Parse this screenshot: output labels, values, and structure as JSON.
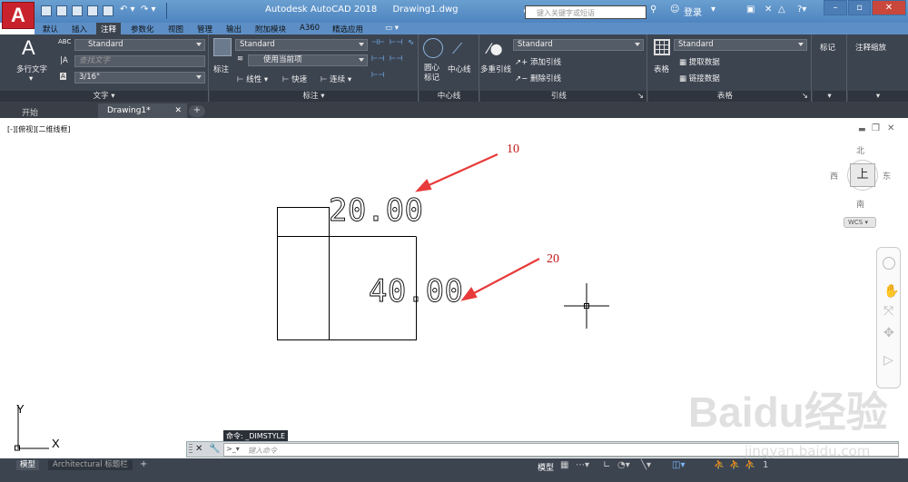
{
  "titlebar": {
    "app_title": "Autodesk AutoCAD 2018",
    "file": "Drawing1.dwg",
    "search_placeholder": "键入关键字或短语",
    "login": "登录"
  },
  "tabs": [
    "默认",
    "插入",
    "注释",
    "参数化",
    "视图",
    "管理",
    "输出",
    "附加模块",
    "A360",
    "精选应用"
  ],
  "active_tab": "注释",
  "ribbon": {
    "text_panel": {
      "big_label": "多行文字",
      "style": "Standard",
      "find_placeholder": "查找文字",
      "height": "3/16\"",
      "title": "文字"
    },
    "dim_panel": {
      "label": "标注",
      "style": "Standard",
      "layer": "使用当前项",
      "linear": "线性",
      "quick": "快速",
      "continuous": "连续",
      "title": "标注"
    },
    "center_panel": {
      "center_mark": "圆心\n标记",
      "center_mark_1": "圆心",
      "center_mark_2": "标记",
      "centerline": "中心线",
      "title": "中心线"
    },
    "leader_panel": {
      "mleader": "多重引线",
      "style": "Standard",
      "add": "添加引线",
      "remove": "删除引线",
      "title": "引线"
    },
    "table_panel": {
      "table": "表格",
      "style": "Standard",
      "extract": "提取数据",
      "link": "链接数据",
      "title": "表格"
    },
    "markup": "标记",
    "scale": "注释缩放"
  },
  "doctabs": {
    "start": "开始",
    "drawing": "Drawing1*"
  },
  "viewport_label": "[-][俯视][二维线框]",
  "viewcube": {
    "north": "北",
    "south": "南",
    "east": "东",
    "west": "西",
    "top": "上",
    "wcs": "WCS"
  },
  "drawing": {
    "dim1": "20.00",
    "dim2": "40.00",
    "callout1": "10",
    "callout2": "20",
    "axis_y": "Y",
    "axis_x": "X"
  },
  "command": {
    "history": "命令: _DIMSTYLE",
    "placeholder": "键入命令"
  },
  "status": {
    "model_tab": "模型",
    "layout_tab": "Architectural 标题栏",
    "model_btn": "模型"
  },
  "watermark": {
    "main": "Baidu经验",
    "sub": "jingyan.baidu.com"
  },
  "colors": {
    "title_bg": "#5b8fc8",
    "ribbon_bg": "#3c4450",
    "accent_red": "#c8232c",
    "arrow_red": "#e83a3a"
  }
}
